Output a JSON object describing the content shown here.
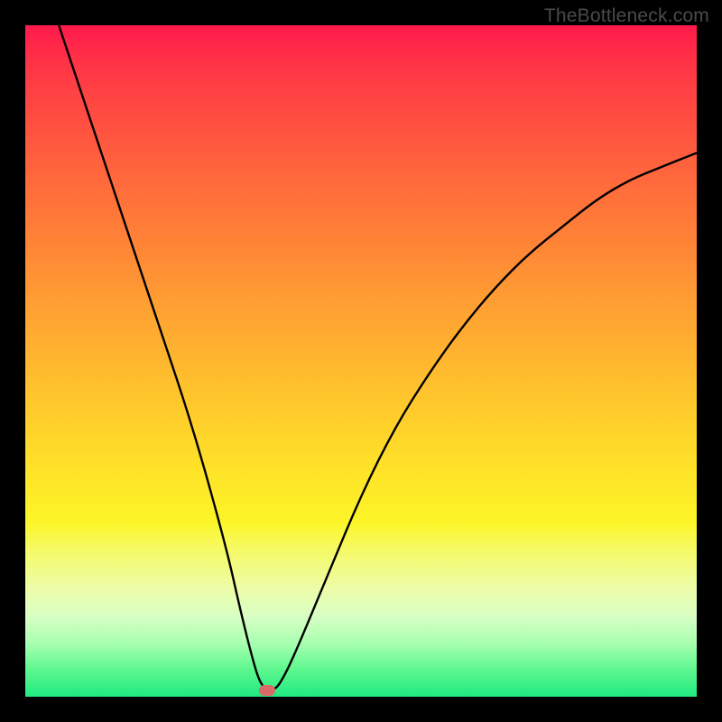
{
  "watermark": "TheBottleneck.com",
  "colors": {
    "frame": "#000000",
    "gradient_top": "#ff1a4b",
    "gradient_bottom": "#1eea80",
    "curve": "#000000",
    "marker": "#d86a6a",
    "watermark": "#4a4a4a"
  },
  "chart_data": {
    "type": "line",
    "title": "",
    "xlabel": "",
    "ylabel": "",
    "xlim": [
      0,
      100
    ],
    "ylim": [
      0,
      100
    ],
    "grid": false,
    "legend": false,
    "series": [
      {
        "name": "bottleneck-curve",
        "x": [
          5,
          10,
          15,
          20,
          25,
          30,
          32,
          34,
          35,
          36,
          37,
          38,
          40,
          45,
          50,
          55,
          60,
          65,
          70,
          75,
          80,
          85,
          90,
          95,
          100
        ],
        "y": [
          100,
          85,
          70,
          55,
          40,
          22,
          13,
          5,
          2,
          1,
          1,
          2,
          6,
          18,
          30,
          40,
          48,
          55,
          61,
          66,
          70,
          74,
          77,
          79,
          81
        ]
      }
    ],
    "marker": {
      "x": 36,
      "y": 1
    },
    "notes": "y encodes bottleneck severity (higher = worse, red region); x is an unlabeled ratio axis; background gradient maps severity color red→green."
  }
}
